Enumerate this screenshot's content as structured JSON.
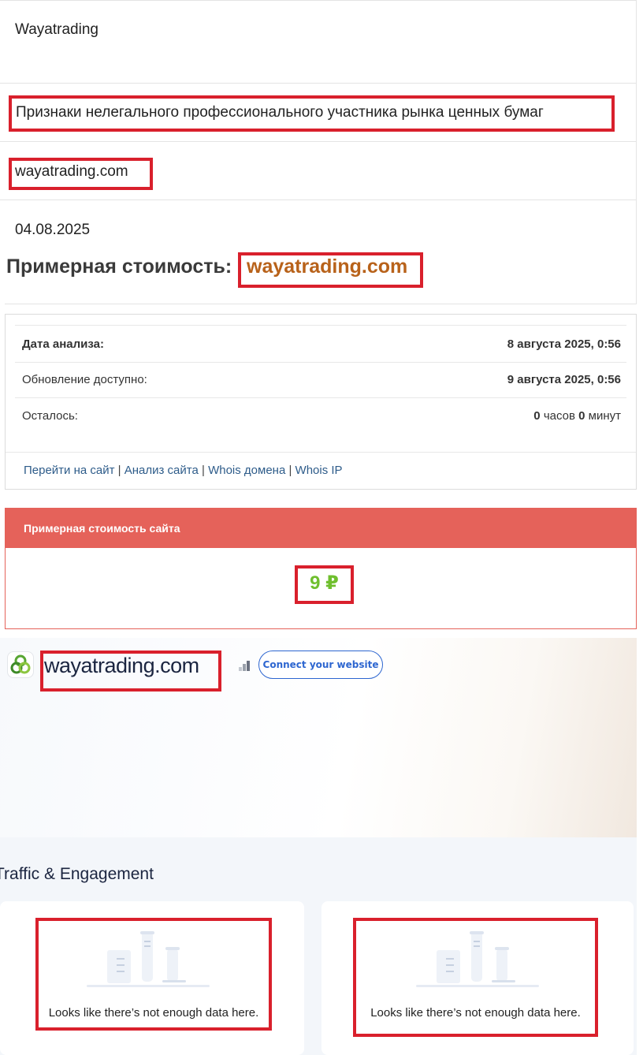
{
  "page": {
    "site_title": "Wayatrading",
    "category": "Признаки нелегального профессионального участника рынка ценных бумаг",
    "domain": "wayatrading.com",
    "date": "04.08.2025"
  },
  "valuation": {
    "heading_prefix": "Примерная стоимость:",
    "heading_domain": "wayatrading.com",
    "rows": [
      {
        "label": "Дата анализа:",
        "value": "8 августа 2025, 0:56"
      },
      {
        "label": "Обновление доступно:",
        "value": "9 августа 2025, 0:56"
      }
    ],
    "remaining": {
      "label": "Осталось:",
      "hours_num": "0",
      "hours_word": "часов",
      "minutes_num": "0",
      "minutes_word": "минут"
    },
    "links": [
      "Перейти на сайт",
      "Анализ сайта",
      "Whois домена",
      "Whois IP"
    ],
    "link_separator": "|",
    "price_title": "Примерная стоимость сайта",
    "price_value": "9 ₽",
    "colors": {
      "accent": "#e5625a",
      "price": "#6fbf2e",
      "domain": "#b8621a"
    }
  },
  "similarweb": {
    "domain": "wayatrading.com",
    "connect_label": "Connect your website",
    "section_title": "Traffic & Engagement",
    "panels": [
      {
        "empty_message": "Looks like there’s not enough data here."
      },
      {
        "empty_message": "Looks like there’s not enough data here."
      }
    ]
  }
}
